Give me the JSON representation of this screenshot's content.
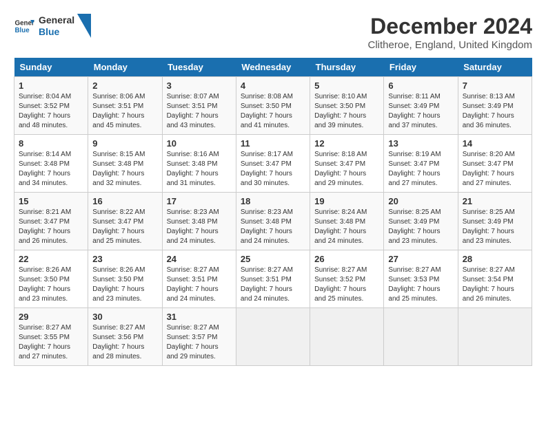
{
  "logo": {
    "line1": "General",
    "line2": "Blue"
  },
  "title": "December 2024",
  "subtitle": "Clitheroe, England, United Kingdom",
  "days_of_week": [
    "Sunday",
    "Monday",
    "Tuesday",
    "Wednesday",
    "Thursday",
    "Friday",
    "Saturday"
  ],
  "weeks": [
    [
      {
        "day": "1",
        "sunrise": "8:04 AM",
        "sunset": "3:52 PM",
        "daylight": "7 hours and 48 minutes."
      },
      {
        "day": "2",
        "sunrise": "8:06 AM",
        "sunset": "3:51 PM",
        "daylight": "7 hours and 45 minutes."
      },
      {
        "day": "3",
        "sunrise": "8:07 AM",
        "sunset": "3:51 PM",
        "daylight": "7 hours and 43 minutes."
      },
      {
        "day": "4",
        "sunrise": "8:08 AM",
        "sunset": "3:50 PM",
        "daylight": "7 hours and 41 minutes."
      },
      {
        "day": "5",
        "sunrise": "8:10 AM",
        "sunset": "3:50 PM",
        "daylight": "7 hours and 39 minutes."
      },
      {
        "day": "6",
        "sunrise": "8:11 AM",
        "sunset": "3:49 PM",
        "daylight": "7 hours and 37 minutes."
      },
      {
        "day": "7",
        "sunrise": "8:13 AM",
        "sunset": "3:49 PM",
        "daylight": "7 hours and 36 minutes."
      }
    ],
    [
      {
        "day": "8",
        "sunrise": "8:14 AM",
        "sunset": "3:48 PM",
        "daylight": "7 hours and 34 minutes."
      },
      {
        "day": "9",
        "sunrise": "8:15 AM",
        "sunset": "3:48 PM",
        "daylight": "7 hours and 32 minutes."
      },
      {
        "day": "10",
        "sunrise": "8:16 AM",
        "sunset": "3:48 PM",
        "daylight": "7 hours and 31 minutes."
      },
      {
        "day": "11",
        "sunrise": "8:17 AM",
        "sunset": "3:47 PM",
        "daylight": "7 hours and 30 minutes."
      },
      {
        "day": "12",
        "sunrise": "8:18 AM",
        "sunset": "3:47 PM",
        "daylight": "7 hours and 29 minutes."
      },
      {
        "day": "13",
        "sunrise": "8:19 AM",
        "sunset": "3:47 PM",
        "daylight": "7 hours and 27 minutes."
      },
      {
        "day": "14",
        "sunrise": "8:20 AM",
        "sunset": "3:47 PM",
        "daylight": "7 hours and 27 minutes."
      }
    ],
    [
      {
        "day": "15",
        "sunrise": "8:21 AM",
        "sunset": "3:47 PM",
        "daylight": "7 hours and 26 minutes."
      },
      {
        "day": "16",
        "sunrise": "8:22 AM",
        "sunset": "3:47 PM",
        "daylight": "7 hours and 25 minutes."
      },
      {
        "day": "17",
        "sunrise": "8:23 AM",
        "sunset": "3:48 PM",
        "daylight": "7 hours and 24 minutes."
      },
      {
        "day": "18",
        "sunrise": "8:23 AM",
        "sunset": "3:48 PM",
        "daylight": "7 hours and 24 minutes."
      },
      {
        "day": "19",
        "sunrise": "8:24 AM",
        "sunset": "3:48 PM",
        "daylight": "7 hours and 24 minutes."
      },
      {
        "day": "20",
        "sunrise": "8:25 AM",
        "sunset": "3:49 PM",
        "daylight": "7 hours and 23 minutes."
      },
      {
        "day": "21",
        "sunrise": "8:25 AM",
        "sunset": "3:49 PM",
        "daylight": "7 hours and 23 minutes."
      }
    ],
    [
      {
        "day": "22",
        "sunrise": "8:26 AM",
        "sunset": "3:50 PM",
        "daylight": "7 hours and 23 minutes."
      },
      {
        "day": "23",
        "sunrise": "8:26 AM",
        "sunset": "3:50 PM",
        "daylight": "7 hours and 23 minutes."
      },
      {
        "day": "24",
        "sunrise": "8:27 AM",
        "sunset": "3:51 PM",
        "daylight": "7 hours and 24 minutes."
      },
      {
        "day": "25",
        "sunrise": "8:27 AM",
        "sunset": "3:51 PM",
        "daylight": "7 hours and 24 minutes."
      },
      {
        "day": "26",
        "sunrise": "8:27 AM",
        "sunset": "3:52 PM",
        "daylight": "7 hours and 25 minutes."
      },
      {
        "day": "27",
        "sunrise": "8:27 AM",
        "sunset": "3:53 PM",
        "daylight": "7 hours and 25 minutes."
      },
      {
        "day": "28",
        "sunrise": "8:27 AM",
        "sunset": "3:54 PM",
        "daylight": "7 hours and 26 minutes."
      }
    ],
    [
      {
        "day": "29",
        "sunrise": "8:27 AM",
        "sunset": "3:55 PM",
        "daylight": "7 hours and 27 minutes."
      },
      {
        "day": "30",
        "sunrise": "8:27 AM",
        "sunset": "3:56 PM",
        "daylight": "7 hours and 28 minutes."
      },
      {
        "day": "31",
        "sunrise": "8:27 AM",
        "sunset": "3:57 PM",
        "daylight": "7 hours and 29 minutes."
      },
      null,
      null,
      null,
      null
    ]
  ]
}
